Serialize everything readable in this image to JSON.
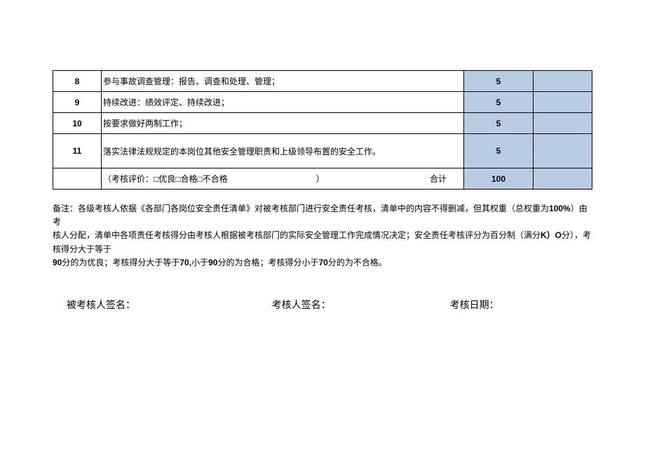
{
  "table": {
    "rows": [
      {
        "num": "8",
        "desc": "参与事故调查管理：报告、调查和处理、管理；",
        "score": "5"
      },
      {
        "num": "9",
        "desc": "持续改进：绩效评定、持续改进；",
        "score": "5"
      },
      {
        "num": "10",
        "desc": "按要求做好两制工作；",
        "score": "5"
      },
      {
        "num": "11",
        "desc": "落实法律法规规定的本岗位其他安全管理职责和上级领导布置的安全工作。",
        "score": "5"
      }
    ],
    "summary": {
      "eval_label": "（考核评价：□优良□合格□不合格",
      "eval_close": "）",
      "total_label": "合计",
      "total_value": "100"
    }
  },
  "notes": {
    "line1_pre": "备注：各级考核人依据《各部门各岗位安全责任清单》对被考核部门进行安全责任考核，清单中的内容不得删减，但其权重（总权重为",
    "line1_bold1": "100%",
    "line1_post": "）由考",
    "line2_pre": "核人分配，清单中各项责任考核得分由考核人根据被考核部门的实际安全管理工作完成情况决定；安全责任考核评分为百分制（满分",
    "line2_bold1": "K）O",
    "line2_mid": "分），考核得分大于等于",
    "line3_bold1": "90",
    "line3_mid1": "分的为优良；考核得分大于等于",
    "line3_bold2": "70,",
    "line3_mid2": "小于",
    "line3_bold3": "90",
    "line3_mid3": "分的为合格；考核得分小于",
    "line3_bold4": "70",
    "line3_end": "分的为不合格。"
  },
  "signatures": {
    "assessee": "被考核人签名：",
    "assessor": "考核人签名：",
    "date": "考核日期："
  }
}
